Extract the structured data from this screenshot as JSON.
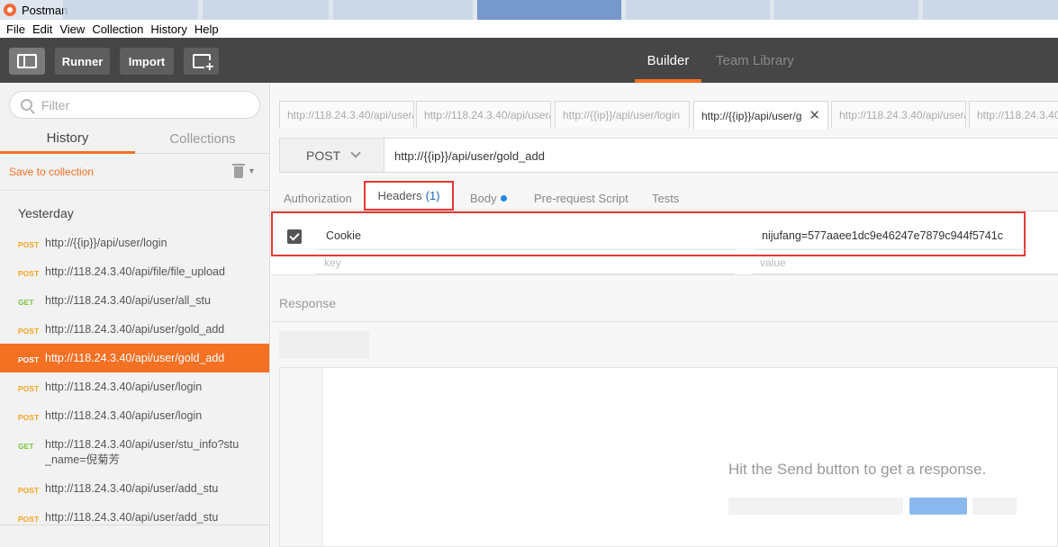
{
  "window": {
    "title": "Postman"
  },
  "menu": [
    "File",
    "Edit",
    "View",
    "Collection",
    "History",
    "Help"
  ],
  "toolbar": {
    "runner_label": "Runner",
    "import_label": "Import",
    "tabs": {
      "builder": "Builder",
      "team_library": "Team Library"
    },
    "active_tab": "Builder",
    "accent_color": "#f47023"
  },
  "sidebar": {
    "filter_placeholder": "Filter",
    "tabs": {
      "history": "History",
      "collections": "Collections"
    },
    "save_to_collection": "Save to collection",
    "group_label": "Yesterday",
    "items": [
      {
        "method": "POST",
        "url": "http://{{ip}}/api/user/login"
      },
      {
        "method": "POST",
        "url": "http://118.24.3.40/api/file/file_upload"
      },
      {
        "method": "GET",
        "url": "http://118.24.3.40/api/user/all_stu"
      },
      {
        "method": "POST",
        "url": "http://118.24.3.40/api/user/gold_add"
      },
      {
        "method": "POST",
        "url": "http://118.24.3.40/api/user/gold_add",
        "active": true
      },
      {
        "method": "POST",
        "url": "http://118.24.3.40/api/user/login"
      },
      {
        "method": "POST",
        "url": "http://118.24.3.40/api/user/login"
      },
      {
        "method": "GET",
        "url": "http://118.24.3.40/api/user/stu_info?stu_name=倪菊芳"
      },
      {
        "method": "POST",
        "url": "http://118.24.3.40/api/user/add_stu"
      },
      {
        "method": "POST",
        "url": "http://118.24.3.40/api/user/add_stu"
      }
    ]
  },
  "request": {
    "tabs": [
      "http://118.24.3.40/api/user/",
      "http://118.24.3.40/api/user/",
      "http://{{ip}}/api/user/login",
      "http://{{ip}}/api/user/g",
      "http://118.24.3.40/api/user/",
      "http://118.24.3.40"
    ],
    "active_tab_index": 3,
    "method": "POST",
    "url": "http://{{ip}}/api/user/gold_add",
    "sub_tabs": {
      "authorization": "Authorization",
      "headers": "Headers",
      "headers_count": "(1)",
      "body": "Body",
      "pre_request": "Pre-request Script",
      "tests": "Tests"
    },
    "headers": {
      "key": "Cookie",
      "value": "nijufang=577aaee1dc9e46247e7879c944f5741c",
      "key_placeholder": "key",
      "value_placeholder": "value"
    }
  },
  "response": {
    "label": "Response",
    "empty_message": "Hit the Send button to get a response."
  }
}
